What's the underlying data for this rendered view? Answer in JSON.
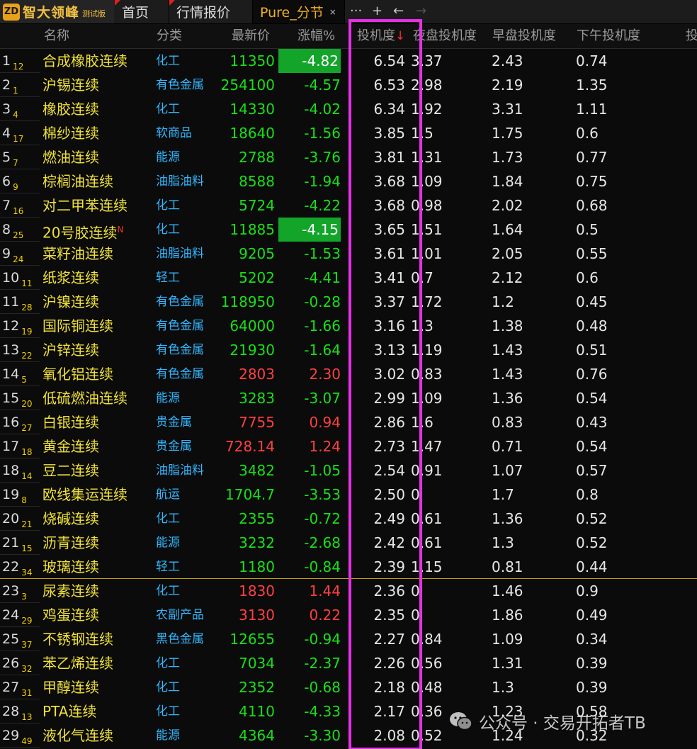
{
  "app": {
    "logo_text": "智大领峰",
    "logo_sub": "测试版",
    "logo_mark": "ZD"
  },
  "tabs": [
    {
      "label": "首页"
    },
    {
      "label": "行情报价"
    },
    {
      "label": "Pure_分节"
    }
  ],
  "toolbar": {
    "more": "···",
    "add": "+",
    "back": "←",
    "forward": "→",
    "close": "×"
  },
  "headers": {
    "name": "名称",
    "category": "分类",
    "price": "最新价",
    "change": "涨幅%",
    "spec": "投机度",
    "sort_arrow": "↓",
    "night": "夜盘投机度",
    "morning": "早盘投机度",
    "afternoon": "下午投机度",
    "extra": "投"
  },
  "colors": {
    "accent": "#f0b020",
    "highlight_box": "#e630e6",
    "down": "#17e017",
    "up": "#ff4040",
    "name": "#f0e23a",
    "category": "#33b7ff"
  },
  "rows": [
    {
      "idx": "1",
      "sub": "12",
      "name": "合成橡胶连续",
      "cat": "化工",
      "price": "11350",
      "chg": "-4.82",
      "dir": "down",
      "hl": true,
      "spec": "6.54",
      "night": "3.37",
      "morning": "2.43",
      "afternoon": "0.74"
    },
    {
      "idx": "2",
      "sub": "1",
      "name": "沪锡连续",
      "cat": "有色金属",
      "price": "254100",
      "chg": "-4.57",
      "dir": "down",
      "spec": "6.53",
      "night": "2.98",
      "morning": "2.19",
      "afternoon": "1.35"
    },
    {
      "idx": "3",
      "sub": "4",
      "name": "橡胶连续",
      "cat": "化工",
      "price": "14330",
      "chg": "-4.02",
      "dir": "down",
      "spec": "6.34",
      "night": "1.92",
      "morning": "3.31",
      "afternoon": "1.11"
    },
    {
      "idx": "4",
      "sub": "17",
      "name": "棉纱连续",
      "cat": "软商品",
      "price": "18640",
      "chg": "-1.56",
      "dir": "down",
      "spec": "3.85",
      "night": "1.5",
      "morning": "1.75",
      "afternoon": "0.6"
    },
    {
      "idx": "5",
      "sub": "7",
      "name": "燃油连续",
      "cat": "能源",
      "price": "2788",
      "chg": "-3.76",
      "dir": "down",
      "spec": "3.81",
      "night": "1.31",
      "morning": "1.73",
      "afternoon": "0.77"
    },
    {
      "idx": "6",
      "sub": "9",
      "name": "棕榈油连续",
      "cat": "油脂油料",
      "price": "8588",
      "chg": "-1.94",
      "dir": "down",
      "spec": "3.68",
      "night": "1.09",
      "morning": "1.84",
      "afternoon": "0.75"
    },
    {
      "idx": "7",
      "sub": "16",
      "name": "对二甲苯连续",
      "cat": "化工",
      "price": "5724",
      "chg": "-4.22",
      "dir": "down",
      "spec": "3.68",
      "night": "0.98",
      "morning": "2.02",
      "afternoon": "0.68"
    },
    {
      "idx": "8",
      "sub": "25",
      "name": "20号胶连续",
      "mark": "N",
      "cat": "化工",
      "price": "11885",
      "chg": "-4.15",
      "dir": "down",
      "hl": true,
      "spec": "3.65",
      "night": "1.51",
      "morning": "1.64",
      "afternoon": "0.5"
    },
    {
      "idx": "9",
      "sub": "24",
      "name": "菜籽油连续",
      "cat": "油脂油料",
      "price": "9205",
      "chg": "-1.53",
      "dir": "down",
      "spec": "3.61",
      "night": "1.01",
      "morning": "2.05",
      "afternoon": "0.55"
    },
    {
      "idx": "10",
      "sub": "11",
      "name": "纸浆连续",
      "cat": "轻工",
      "price": "5202",
      "chg": "-4.41",
      "dir": "down",
      "spec": "3.41",
      "night": "0.7",
      "morning": "2.12",
      "afternoon": "0.6"
    },
    {
      "idx": "11",
      "sub": "28",
      "name": "沪镍连续",
      "cat": "有色金属",
      "price": "118950",
      "chg": "-0.28",
      "dir": "down",
      "spec": "3.37",
      "night": "1.72",
      "morning": "1.2",
      "afternoon": "0.45"
    },
    {
      "idx": "12",
      "sub": "19",
      "name": "国际铜连续",
      "cat": "有色金属",
      "price": "64000",
      "chg": "-1.66",
      "dir": "down",
      "spec": "3.16",
      "night": "1.3",
      "morning": "1.38",
      "afternoon": "0.48"
    },
    {
      "idx": "13",
      "sub": "22",
      "name": "沪锌连续",
      "cat": "有色金属",
      "price": "21930",
      "chg": "-1.64",
      "dir": "down",
      "spec": "3.13",
      "night": "1.19",
      "morning": "1.43",
      "afternoon": "0.51"
    },
    {
      "idx": "14",
      "sub": "5",
      "name": "氧化铝连续",
      "cat": "有色金属",
      "price": "2803",
      "chg": "2.30",
      "dir": "up",
      "spec": "3.02",
      "night": "0.83",
      "morning": "1.43",
      "afternoon": "0.76"
    },
    {
      "idx": "15",
      "sub": "20",
      "name": "低硫燃油连续",
      "cat": "能源",
      "price": "3283",
      "chg": "-3.07",
      "dir": "down",
      "spec": "2.99",
      "night": "1.09",
      "morning": "1.36",
      "afternoon": "0.54"
    },
    {
      "idx": "16",
      "sub": "27",
      "name": "白银连续",
      "cat": "贵金属",
      "price": "7755",
      "chg": "0.94",
      "dir": "up",
      "spec": "2.86",
      "night": "1.6",
      "morning": "0.83",
      "afternoon": "0.43"
    },
    {
      "idx": "17",
      "sub": "18",
      "name": "黄金连续",
      "cat": "贵金属",
      "price": "728.14",
      "chg": "1.24",
      "dir": "up",
      "spec": "2.73",
      "night": "1.47",
      "morning": "0.71",
      "afternoon": "0.54"
    },
    {
      "idx": "18",
      "sub": "14",
      "name": "豆二连续",
      "cat": "油脂油料",
      "price": "3482",
      "chg": "-1.05",
      "dir": "down",
      "spec": "2.54",
      "night": "0.91",
      "morning": "1.07",
      "afternoon": "0.57"
    },
    {
      "idx": "19",
      "sub": "8",
      "name": "欧线集运连续",
      "cat": "航运",
      "price": "1704.7",
      "chg": "-3.53",
      "dir": "down",
      "spec": "2.50",
      "night": "0",
      "morning": "1.7",
      "afternoon": "0.8"
    },
    {
      "idx": "20",
      "sub": "21",
      "name": "烧碱连续",
      "cat": "化工",
      "price": "2355",
      "chg": "-0.72",
      "dir": "down",
      "spec": "2.49",
      "night": "0.61",
      "morning": "1.36",
      "afternoon": "0.52"
    },
    {
      "idx": "21",
      "sub": "15",
      "name": "沥青连续",
      "cat": "能源",
      "price": "3232",
      "chg": "-2.68",
      "dir": "down",
      "spec": "2.42",
      "night": "0.61",
      "morning": "1.3",
      "afternoon": "0.52"
    },
    {
      "idx": "22",
      "sub": "34",
      "name": "玻璃连续",
      "cat": "轻工",
      "price": "1180",
      "chg": "-0.84",
      "dir": "down",
      "spec": "2.39",
      "night": "1.15",
      "morning": "0.81",
      "afternoon": "0.44"
    },
    {
      "idx": "23",
      "sub": "3",
      "name": "尿素连续",
      "cat": "化工",
      "price": "1830",
      "chg": "1.44",
      "dir": "up",
      "spec": "2.36",
      "night": "0",
      "morning": "1.46",
      "afternoon": "0.9"
    },
    {
      "idx": "24",
      "sub": "29",
      "name": "鸡蛋连续",
      "cat": "农副产品",
      "price": "3130",
      "chg": "0.22",
      "dir": "up",
      "spec": "2.35",
      "night": "0",
      "morning": "1.86",
      "afternoon": "0.49"
    },
    {
      "idx": "25",
      "sub": "37",
      "name": "不锈钢连续",
      "cat": "黑色金属",
      "price": "12655",
      "chg": "-0.94",
      "dir": "down",
      "spec": "2.27",
      "night": "0.84",
      "morning": "1.09",
      "afternoon": "0.34"
    },
    {
      "idx": "26",
      "sub": "32",
      "name": "苯乙烯连续",
      "cat": "化工",
      "price": "7034",
      "chg": "-2.37",
      "dir": "down",
      "spec": "2.26",
      "night": "0.56",
      "morning": "1.31",
      "afternoon": "0.39"
    },
    {
      "idx": "27",
      "sub": "31",
      "name": "甲醇连续",
      "cat": "化工",
      "price": "2352",
      "chg": "-0.68",
      "dir": "down",
      "spec": "2.18",
      "night": "0.48",
      "morning": "1.3",
      "afternoon": "0.39"
    },
    {
      "idx": "28",
      "sub": "13",
      "name": "PTA连续",
      "cat": "化工",
      "price": "4110",
      "chg": "-4.33",
      "dir": "down",
      "spec": "2.17",
      "night": "0.36",
      "morning": "1.23",
      "afternoon": "0.58"
    },
    {
      "idx": "29",
      "sub": "49",
      "name": "液化气连续",
      "cat": "能源",
      "price": "4364",
      "chg": "-3.30",
      "dir": "down",
      "spec": "2.08",
      "night": "0.52",
      "morning": "1.24",
      "afternoon": "0.32"
    }
  ],
  "watermark": {
    "text": "公众号 · 交易开拓者TB",
    "icon": "wechat-icon"
  }
}
